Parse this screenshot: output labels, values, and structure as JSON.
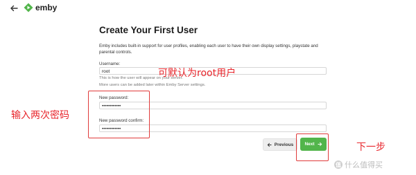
{
  "header": {
    "back_icon": "arrow-left-icon",
    "logo_text": "emby",
    "brand_color": "#52b54b"
  },
  "form": {
    "title": "Create Your First User",
    "intro": "Emby includes built-in support for user profiles, enabling each user to have their own display settings, playstate and parental controls.",
    "username_label": "Username:",
    "username_value": "root",
    "username_hint1": "This is how the user will appear on your server.",
    "username_hint2": "More users can be added later within Emby Server settings.",
    "password_label": "New password:",
    "password_value": "••••••••••••",
    "confirm_label": "New password confirm:",
    "confirm_value": "••••••••••••"
  },
  "buttons": {
    "previous_label": "Previous",
    "next_label": "Next"
  },
  "annotations": {
    "default_root": "可默认为root用户",
    "enter_password_twice": "输入两次密码",
    "next_step": "下一步",
    "color": "#e8262c"
  },
  "watermark": {
    "badge": "值",
    "text": "什么值得买"
  }
}
